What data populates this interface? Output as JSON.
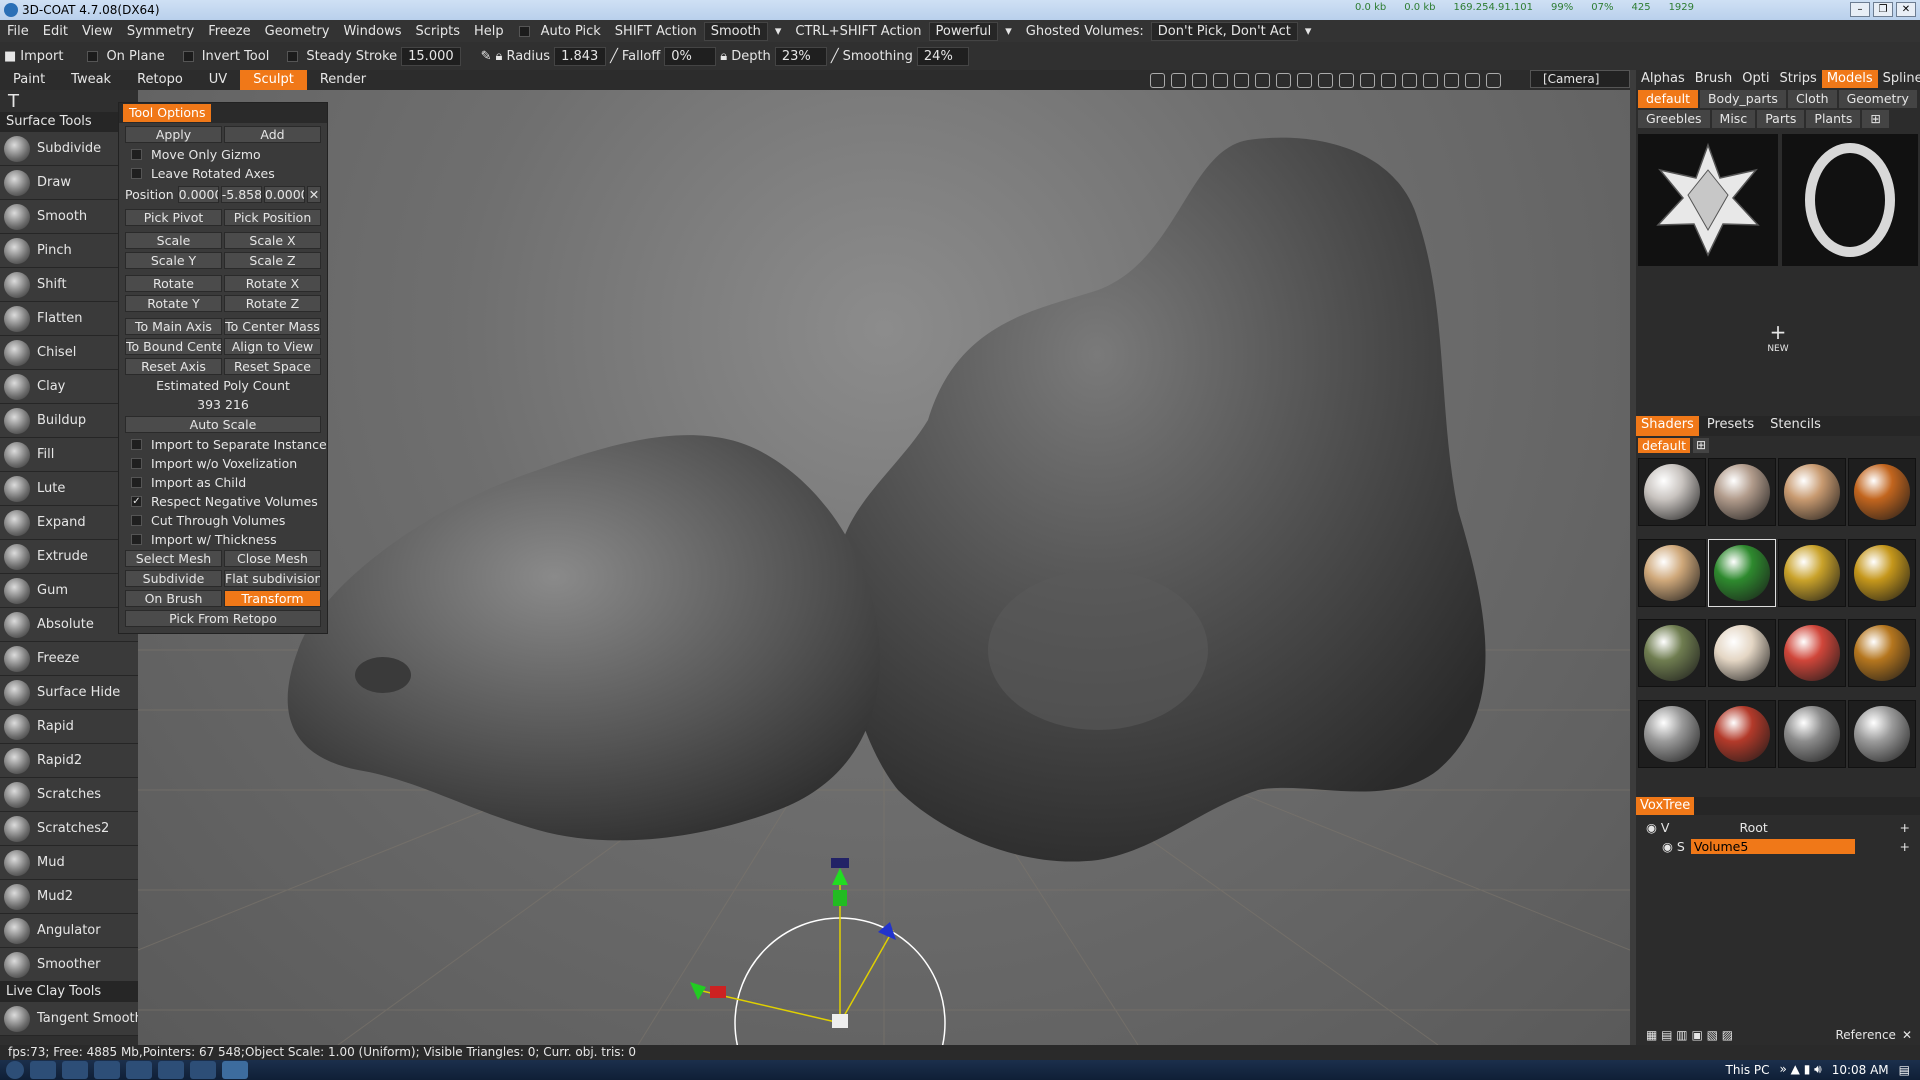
{
  "app": {
    "title": "3D-COAT 4.7.08(DX64)",
    "stats": [
      "0.0 kb",
      "0.0 kb",
      "169.254.91.101",
      "99%",
      "07%",
      "425",
      "1929"
    ]
  },
  "menu": {
    "items": [
      "File",
      "Edit",
      "View",
      "Symmetry",
      "Freeze",
      "Geometry",
      "Windows",
      "Scripts",
      "Help"
    ],
    "auto_pick": "Auto Pick",
    "shift_action": "SHIFT Action",
    "shift_value": "Smooth",
    "ctrl_shift_action": "CTRL+SHIFT Action",
    "ctrl_shift_value": "Powerful",
    "ghosted": "Ghosted Volumes:",
    "ghosted_value": "Don't Pick, Don't Act"
  },
  "toolbar": {
    "import": "Import",
    "on_plane": "On Plane",
    "invert_tool": "Invert Tool",
    "steady_stroke": "Steady Stroke",
    "steady_value": "15.000",
    "radius": "Radius",
    "radius_value": "1.843",
    "falloff": "Falloff",
    "falloff_value": "0%",
    "depth": "Depth",
    "depth_value": "23%",
    "smoothing": "Smoothing",
    "smoothing_value": "24%"
  },
  "rooms": [
    {
      "label": "Paint",
      "active": false
    },
    {
      "label": "Tweak",
      "active": false
    },
    {
      "label": "Retopo",
      "active": false
    },
    {
      "label": "UV",
      "active": false
    },
    {
      "label": "Sculpt",
      "active": true
    },
    {
      "label": "Render",
      "active": false
    }
  ],
  "camera": "[Camera]",
  "left_panel": {
    "header": "Surface Tools",
    "tools": [
      "Subdivide",
      "Draw",
      "Smooth",
      "Pinch",
      "Shift",
      "Flatten",
      "Chisel",
      "Clay",
      "Buildup",
      "Fill",
      "Lute",
      "Expand",
      "Extrude",
      "Gum",
      "Absolute",
      "Freeze",
      "Surface Hide",
      "Rapid",
      "Rapid2",
      "Scratches",
      "Scratches2",
      "Mud",
      "Mud2",
      "Angulator",
      "Smoother"
    ],
    "live_clay_header": "Live Clay Tools",
    "live_clay_tool": "Tangent Smooth"
  },
  "tool_options": {
    "title": "Tool Options",
    "apply": "Apply",
    "add": "Add",
    "move_only_gizmo": "Move Only Gizmo",
    "leave_rotated_axes": "Leave Rotated Axes",
    "position_label": "Position",
    "pos_x": "0.0000",
    "pos_y": "-5.858",
    "pos_z": "0.0000",
    "pick_pivot": "Pick Pivot",
    "pick_position": "Pick Position",
    "scale": "Scale",
    "scale_x": "Scale X",
    "scale_y": "Scale Y",
    "scale_z": "Scale Z",
    "rotate": "Rotate",
    "rotate_x": "Rotate X",
    "rotate_y": "Rotate Y",
    "rotate_z": "Rotate Z",
    "to_main_axis": "To Main Axis",
    "to_center_mass": "To Center Mass",
    "to_bound_center": "To Bound Cente",
    "align_to_view": "Align to View",
    "reset_axis": "Reset Axis",
    "reset_space": "Reset Space",
    "estimated_poly": "Estimated Poly Count",
    "poly_value": "393 216",
    "auto_scale": "Auto Scale",
    "import_separate": "Import to Separate Instance",
    "import_wo_vox": "Import w/o Voxelization",
    "import_as_child": "Import as Child",
    "respect_negative": "Respect Negative Volumes",
    "cut_through": "Cut Through Volumes",
    "import_thickness": "Import w/ Thickness",
    "select_mesh": "Select Mesh",
    "close_mesh": "Close Mesh",
    "subdivide": "Subdivide",
    "flat_subdivision": "Flat subdivision",
    "on_brush": "On Brush",
    "transform": "Transform",
    "pick_from_retopo": "Pick From Retopo"
  },
  "right_panel": {
    "tabs": [
      {
        "label": "Alphas",
        "active": false
      },
      {
        "label": "Brush",
        "active": false
      },
      {
        "label": "Opti",
        "active": false
      },
      {
        "label": "Strips",
        "active": false
      },
      {
        "label": "Models",
        "active": true
      },
      {
        "label": "Splines",
        "active": false
      }
    ],
    "subtabs_row1": [
      {
        "label": "default",
        "active": true
      },
      {
        "label": "Body_parts",
        "active": false
      },
      {
        "label": "Cloth",
        "active": false
      },
      {
        "label": "Geometry",
        "active": false
      }
    ],
    "subtabs_row2": [
      {
        "label": "Greebles",
        "active": false
      },
      {
        "label": "Misc",
        "active": false
      },
      {
        "label": "Parts",
        "active": false
      },
      {
        "label": "Plants",
        "active": false
      }
    ],
    "new_label": "NEW",
    "shader_tabs": [
      {
        "label": "Shaders",
        "active": true
      },
      {
        "label": "Presets",
        "active": false
      },
      {
        "label": "Stencils",
        "active": false
      }
    ],
    "shader_set": "default",
    "shader_colors": [
      "#c9c4c0",
      "#b29c8c",
      "#c89a70",
      "#c2651e",
      "#cfa87a",
      "#2e8a2e",
      "#c9a22a",
      "#c5971b",
      "#6f7d50",
      "#e4d6c4",
      "#d0463a",
      "#b5761e",
      "#9a9a9a",
      "#b33a2a",
      "#8c8c8c",
      "#9b9b9b"
    ],
    "voxtree": "VoxTree",
    "root": "Root",
    "volume": "Volume5",
    "reference": "Reference"
  },
  "status": "fps:73;     Free: 4885 Mb,Pointers: 67 548;Object Scale: 1.00 (Uniform); Visible  Triangles: 0; Curr. obj. tris: 0",
  "taskbar": {
    "this_pc": "This PC",
    "time": "10:08 AM"
  }
}
